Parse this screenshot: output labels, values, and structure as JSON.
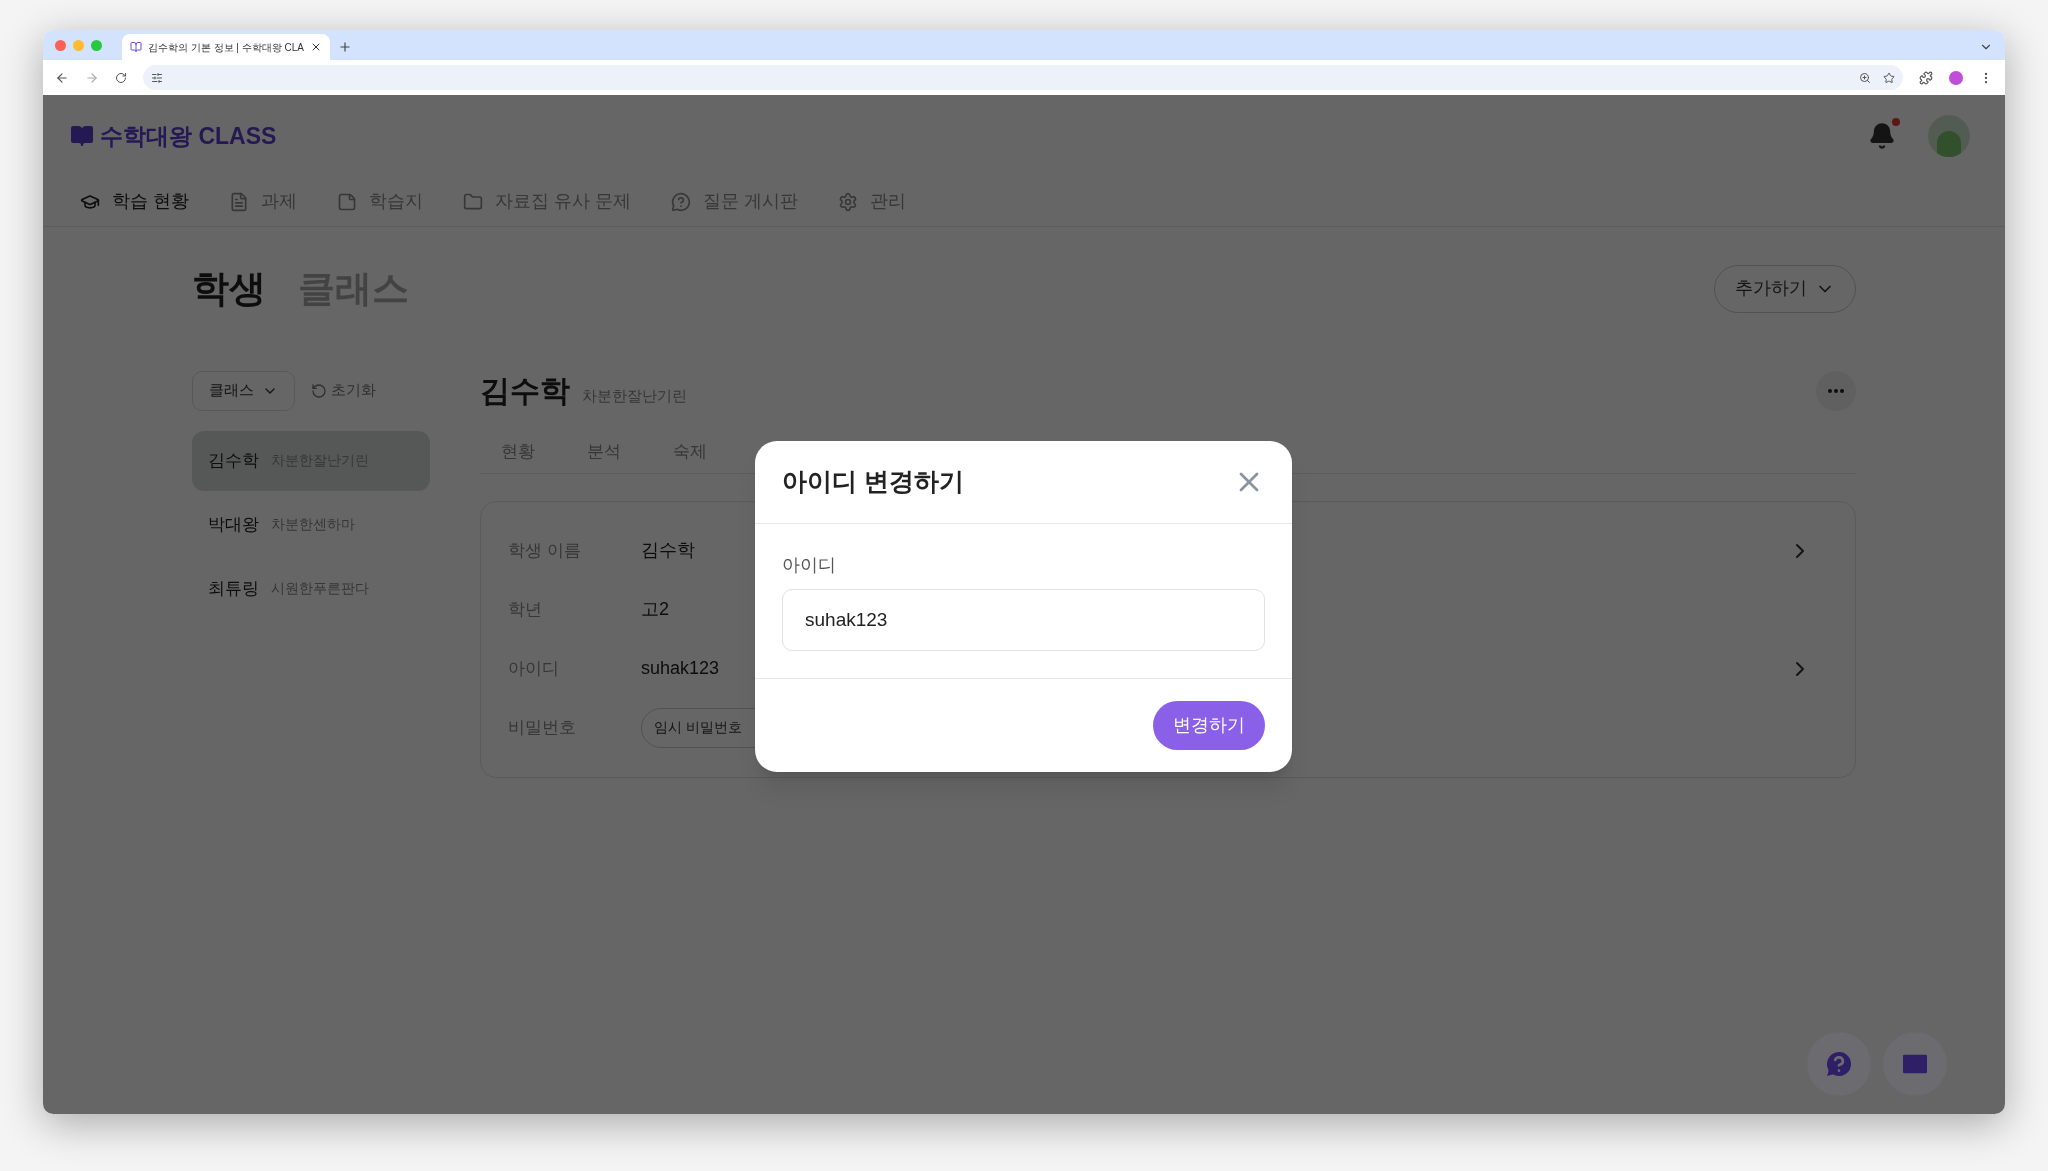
{
  "browser": {
    "tab_title": "김수학의 기본 정보 | 수학대왕 CLA"
  },
  "header": {
    "logo": "수학대왕 CLASS",
    "has_notification": true
  },
  "nav": [
    {
      "label": "학습 현황",
      "selected": true,
      "kind": "cap"
    },
    {
      "label": "과제",
      "selected": false,
      "kind": "doc"
    },
    {
      "label": "학습지",
      "selected": false,
      "kind": "sheet"
    },
    {
      "label": "자료집 유사 문제",
      "selected": false,
      "kind": "folder"
    },
    {
      "label": "질문 게시판",
      "selected": false,
      "kind": "question"
    },
    {
      "label": "관리",
      "selected": false,
      "kind": "gear"
    }
  ],
  "page_tabs": [
    {
      "label": "학생",
      "selected": true
    },
    {
      "label": "클래스",
      "selected": false
    }
  ],
  "add_button": "추가하기",
  "filter": {
    "class_dropdown": "클래스",
    "reset": "초기화"
  },
  "students": [
    {
      "name": "김수학",
      "nickname": "차분한잘난기린",
      "selected": true
    },
    {
      "name": "박대왕",
      "nickname": "차분한센하마",
      "selected": false
    },
    {
      "name": "최튜링",
      "nickname": "시원한푸른판다",
      "selected": false
    }
  ],
  "detail": {
    "name": "김수학",
    "nickname": "차분한잘난기린",
    "tabs": [
      "현황",
      "분석",
      "숙제"
    ]
  },
  "info_rows": [
    {
      "label": "학생 이름",
      "value": "김수학",
      "kind": "text",
      "has_chevron": true
    },
    {
      "label": "학년",
      "value": "고2",
      "kind": "text",
      "has_chevron": false
    },
    {
      "label": "아이디",
      "value": "suhak123",
      "kind": "text",
      "has_chevron": true
    },
    {
      "label": "비밀번호",
      "value": "임시 비밀번호",
      "kind": "button",
      "has_chevron": false
    }
  ],
  "modal": {
    "title": "아이디 변경하기",
    "field_label": "아이디",
    "value": "suhak123",
    "submit": "변경하기"
  }
}
